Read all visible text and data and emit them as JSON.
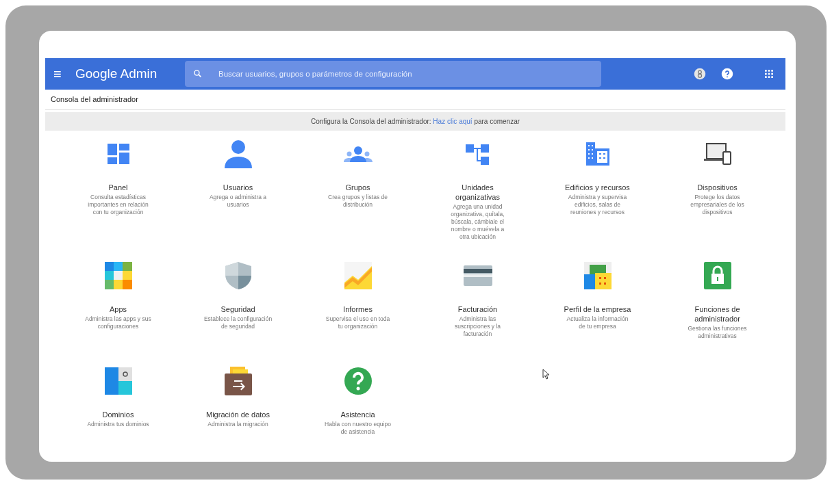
{
  "header": {
    "menu_glyph": "≡",
    "title": "Google Admin",
    "search": {
      "placeholder": "Buscar usuarios, grupos o parámetros de configuración"
    }
  },
  "breadcrumb": "Consola del administrador",
  "banner": {
    "text_before": "Configura la Consola del administrador:",
    "link": "Haz clic aquí",
    "text_after": "para comenzar"
  },
  "cards": [
    {
      "title": "Panel",
      "description": "Consulta estadísticas importantes en relación con tu organización"
    },
    {
      "title": "Usuarios",
      "description": "Agrega o administra a usuarios"
    },
    {
      "title": "Grupos",
      "description": "Crea grupos y listas de distribución"
    },
    {
      "title": "Unidades organizativas",
      "description": "Agrega una unidad organizativa, quítala, búscala, cámbiale el nombre o muévela a otra ubicación"
    },
    {
      "title": "Edificios y recursos",
      "description": "Administra y supervisa edificios, salas de reuniones y recursos"
    },
    {
      "title": "Dispositivos",
      "description": "Protege los datos empresariales de los dispositivos"
    },
    {
      "title": "Apps",
      "description": "Administra las apps y sus configuraciones"
    },
    {
      "title": "Seguridad",
      "description": "Establece la configuración de seguridad"
    },
    {
      "title": "Informes",
      "description": "Supervisa el uso en toda tu organización"
    },
    {
      "title": "Facturación",
      "description": "Administra las suscripciones y la facturación"
    },
    {
      "title": "Perfil de la empresa",
      "description": "Actualiza la información de tu empresa"
    },
    {
      "title": "Funciones de administrador",
      "description": "Gestiona las funciones administrativas"
    },
    {
      "title": "Dominios",
      "description": "Administra tus dominios"
    },
    {
      "title": "Migración de datos",
      "description": "Administra la migración"
    },
    {
      "title": "Asistencia",
      "description": "Habla con nuestro equipo de asistencia"
    }
  ]
}
